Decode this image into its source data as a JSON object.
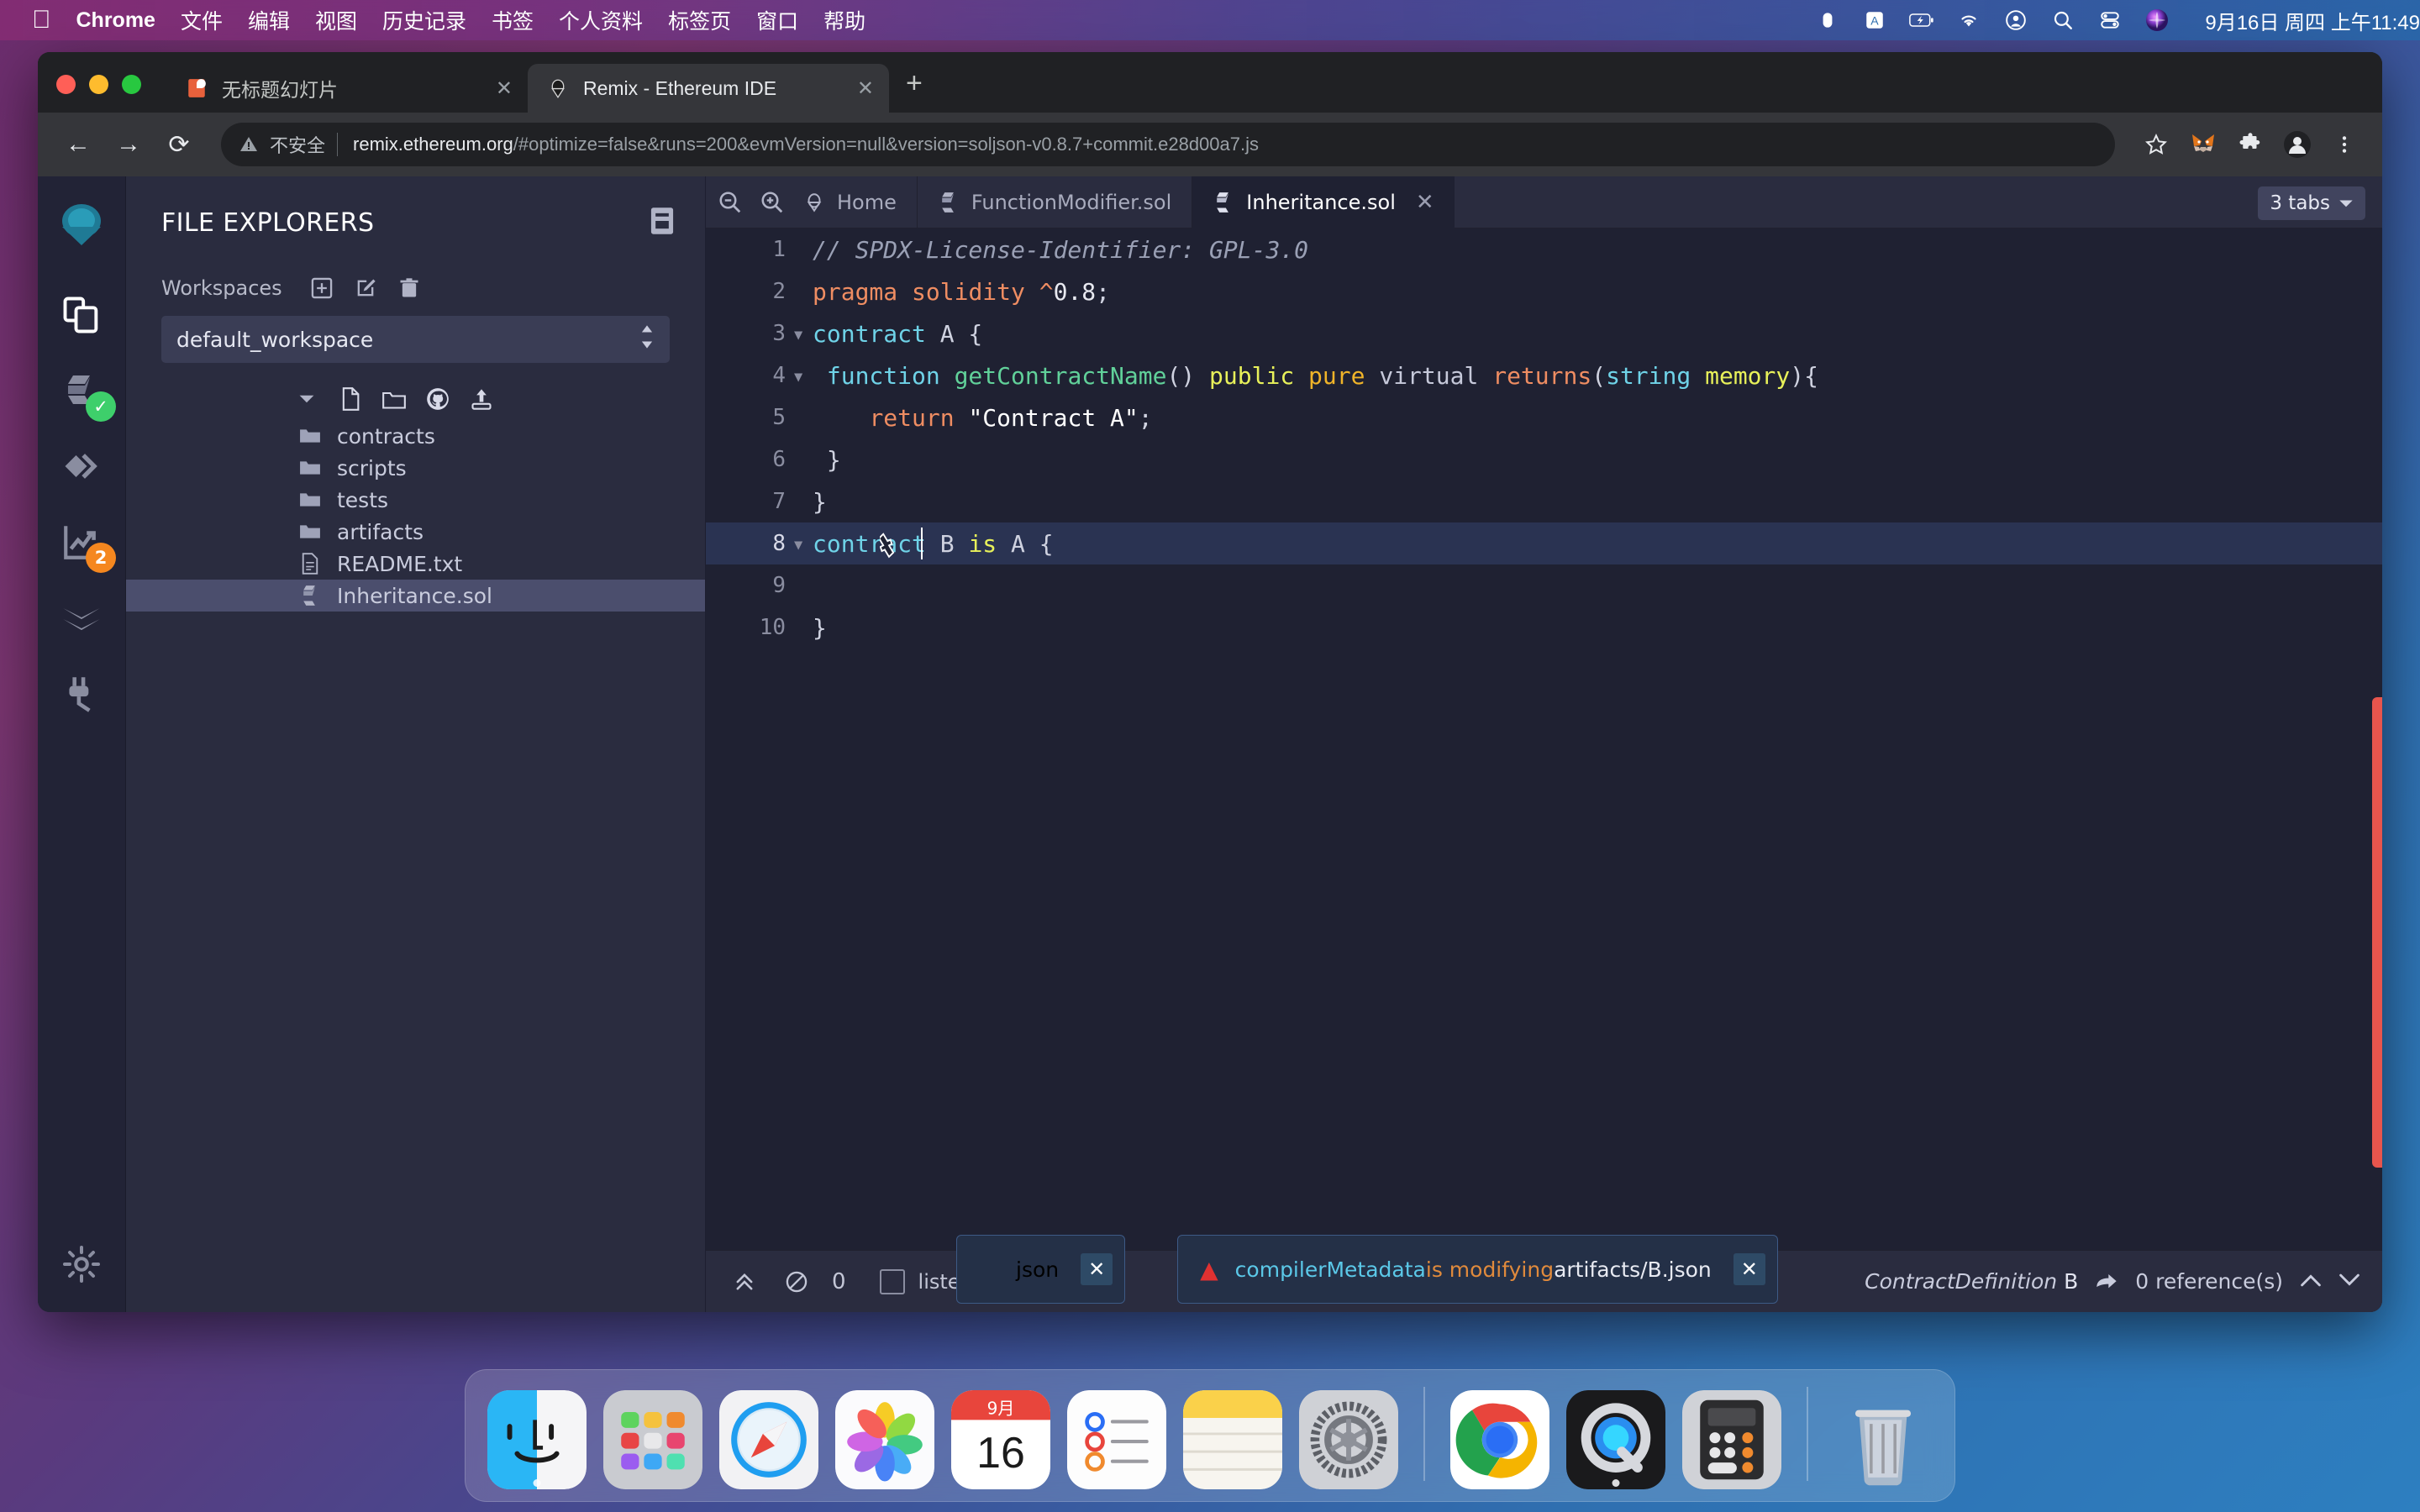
{
  "menubar": {
    "apple_icon": "apple-logo-icon",
    "app_name": "Chrome",
    "items": [
      "文件",
      "编辑",
      "视图",
      "历史记录",
      "书签",
      "个人资料",
      "标签页",
      "窗口",
      "帮助"
    ],
    "status_icons": [
      "screen-record-icon",
      "input-source-icon",
      "battery-charging-icon",
      "wifi-icon",
      "control-center-icon",
      "spotlight-search-icon",
      "display-toggle-icon",
      "siri-icon"
    ],
    "clock": "9月16日 周四 上午11:49"
  },
  "browser": {
    "tabs": [
      {
        "title": "无标题幻灯片",
        "favicon": "slides-icon",
        "active": false
      },
      {
        "title": "Remix - Ethereum IDE",
        "favicon": "remix-icon",
        "active": true
      }
    ],
    "new_tab_label": "+",
    "close_label": "✕",
    "nav": {
      "back": "←",
      "forward": "→",
      "reload": "⟳"
    },
    "omnibox": {
      "not_secure_label": "不安全",
      "warning_icon": "warning-triangle-icon",
      "url_domain": "remix.ethereum.org",
      "url_path": "/#optimize=false&runs=200&evmVersion=null&version=soljson-v0.8.7+commit.e28d00a7.js"
    },
    "toolbar_icons": [
      "bookmark-star-icon",
      "metamask-fox-icon",
      "extensions-puzzle-icon",
      "profile-avatar-icon",
      "three-dot-menu-icon"
    ]
  },
  "remix": {
    "iconbar": [
      {
        "name": "remix-logo-icon",
        "badge": null
      },
      {
        "name": "file-explorer-icon",
        "badge": null
      },
      {
        "name": "solidity-compiler-icon",
        "badge": "✓",
        "badge_type": "ok"
      },
      {
        "name": "deploy-run-icon",
        "badge": null
      },
      {
        "name": "solidity-analysis-icon",
        "badge": "2",
        "badge_type": "num"
      },
      {
        "name": "testing-icon",
        "badge": null
      },
      {
        "name": "plugin-manager-icon",
        "badge": null
      },
      {
        "name": "settings-gear-icon",
        "badge": null
      }
    ],
    "explorer": {
      "title": "FILE EXPLORERS",
      "panel_icon": "workspace-panel-icon",
      "workspaces_label": "Workspaces",
      "workspace_actions": [
        "add-workspace-icon",
        "edit-workspace-icon",
        "delete-workspace-icon"
      ],
      "selected_workspace": "default_workspace",
      "root_actions": [
        "new-file-icon",
        "new-folder-icon",
        "github-clone-icon",
        "publish-gist-icon"
      ],
      "tree": [
        {
          "name": "contracts",
          "type": "folder",
          "selected": false
        },
        {
          "name": "scripts",
          "type": "folder",
          "selected": false
        },
        {
          "name": "tests",
          "type": "folder",
          "selected": false
        },
        {
          "name": "artifacts",
          "type": "folder",
          "selected": false
        },
        {
          "name": "README.txt",
          "type": "file",
          "selected": false
        },
        {
          "name": "Inheritance.sol",
          "type": "solidity",
          "selected": true
        }
      ]
    },
    "editor": {
      "zoom_out_icon": "zoom-out-icon",
      "zoom_in_icon": "zoom-in-icon",
      "tabs": [
        {
          "label": "Home",
          "icon": "remix-home-icon",
          "active": false,
          "closable": false
        },
        {
          "label": "FunctionModifier.sol",
          "icon": "solidity-file-icon",
          "active": false,
          "closable": false
        },
        {
          "label": "Inheritance.sol",
          "icon": "solidity-file-icon",
          "active": true,
          "closable": true
        }
      ],
      "tab_count_label": "3 tabs",
      "file_name": "Inheritance.sol",
      "language": "solidity",
      "cursor_line": 8,
      "highlighted_line": 8,
      "lines": [
        {
          "n": 1,
          "fold": false,
          "tokens": [
            {
              "t": "// SPDX-License-Identifier: GPL-3.0",
              "c": "cm"
            }
          ]
        },
        {
          "n": 2,
          "fold": false,
          "tokens": [
            {
              "t": "pragma",
              "c": "kw"
            },
            {
              "t": " ",
              "c": "pl"
            },
            {
              "t": "solidity",
              "c": "kw"
            },
            {
              "t": " ",
              "c": "pl"
            },
            {
              "t": "^",
              "c": "kw"
            },
            {
              "t": "0.8",
              "c": "num"
            },
            {
              "t": ";",
              "c": "pl"
            }
          ]
        },
        {
          "n": 3,
          "fold": true,
          "tokens": [
            {
              "t": "contract",
              "c": "kw2"
            },
            {
              "t": " A {",
              "c": "pl"
            }
          ]
        },
        {
          "n": 4,
          "fold": true,
          "tokens": [
            {
              "t": " function",
              "c": "kw2"
            },
            {
              "t": " ",
              "c": "pl"
            },
            {
              "t": "getContractName",
              "c": "fn"
            },
            {
              "t": "() ",
              "c": "pl"
            },
            {
              "t": "public",
              "c": "vis"
            },
            {
              "t": " ",
              "c": "pl"
            },
            {
              "t": "pure",
              "c": "pure"
            },
            {
              "t": " ",
              "c": "pl"
            },
            {
              "t": "virtual",
              "c": "vir"
            },
            {
              "t": " ",
              "c": "pl"
            },
            {
              "t": "returns",
              "c": "kw"
            },
            {
              "t": "(",
              "c": "pl"
            },
            {
              "t": "string",
              "c": "typ"
            },
            {
              "t": " ",
              "c": "pl"
            },
            {
              "t": "memory",
              "c": "vis"
            },
            {
              "t": "){",
              "c": "pl"
            }
          ]
        },
        {
          "n": 5,
          "fold": false,
          "tokens": [
            {
              "t": "    ",
              "c": "pl"
            },
            {
              "t": "return",
              "c": "kw"
            },
            {
              "t": " ",
              "c": "pl"
            },
            {
              "t": "\"Contract A\"",
              "c": "str"
            },
            {
              "t": ";",
              "c": "pl"
            }
          ]
        },
        {
          "n": 6,
          "fold": false,
          "tokens": [
            {
              "t": " }",
              "c": "pl"
            }
          ]
        },
        {
          "n": 7,
          "fold": false,
          "tokens": [
            {
              "t": "}",
              "c": "pl"
            }
          ]
        },
        {
          "n": 8,
          "fold": true,
          "tokens": [
            {
              "t": "contract",
              "c": "kw2"
            },
            {
              "t": " B ",
              "c": "pl"
            },
            {
              "t": "is",
              "c": "vis"
            },
            {
              "t": " A {",
              "c": "pl"
            }
          ]
        },
        {
          "n": 9,
          "fold": false,
          "tokens": [
            {
              "t": "",
              "c": "pl"
            }
          ]
        },
        {
          "n": 10,
          "fold": false,
          "tokens": [
            {
              "t": "}",
              "c": "pl"
            }
          ]
        }
      ]
    },
    "statusbar": {
      "expand_icon": "chevron-double-up-icon",
      "clear_icon": "no-entry-icon",
      "count": "0",
      "listen_label": "listen on netw",
      "listen_checked": false,
      "context_prefix": "ContractDefinition",
      "context_name": "B",
      "jump_icon": "jump-to-icon",
      "references": "0 reference(s)",
      "prev_icon": "chevron-up-icon",
      "next_icon": "chevron-down-icon"
    },
    "toasts": [
      {
        "icon": "warning-triangle-icon",
        "part1": "compilerMetadata",
        "part2": " is modifying",
        "part3": "artifacts/B.json",
        "close": "✕"
      },
      {
        "icon": "warning-triangle-icon",
        "part1": "",
        "part2": "",
        "part3": "json",
        "close": "✕"
      }
    ]
  },
  "dock": {
    "items": [
      {
        "name": "finder-icon",
        "running": true
      },
      {
        "name": "launchpad-icon",
        "running": false
      },
      {
        "name": "safari-icon",
        "running": false
      },
      {
        "name": "photos-icon",
        "running": false
      },
      {
        "name": "calendar-icon",
        "running": false,
        "month": "9月",
        "day": "16"
      },
      {
        "name": "reminders-icon",
        "running": false
      },
      {
        "name": "notes-icon",
        "running": false
      },
      {
        "name": "system-preferences-icon",
        "running": false
      },
      {
        "name": "chrome-icon",
        "running": true
      },
      {
        "name": "quicktime-icon",
        "running": true
      },
      {
        "name": "calculator-icon",
        "running": false
      },
      {
        "name": "trash-icon",
        "running": false
      }
    ]
  },
  "colors": {
    "accent_blue": "#2d7fc0",
    "remix_bg": "#2a2c3f",
    "editor_bg": "#1f2132",
    "badge_green": "#3ecf6b",
    "badge_orange": "#f5871f",
    "warning_red": "#e03131"
  }
}
